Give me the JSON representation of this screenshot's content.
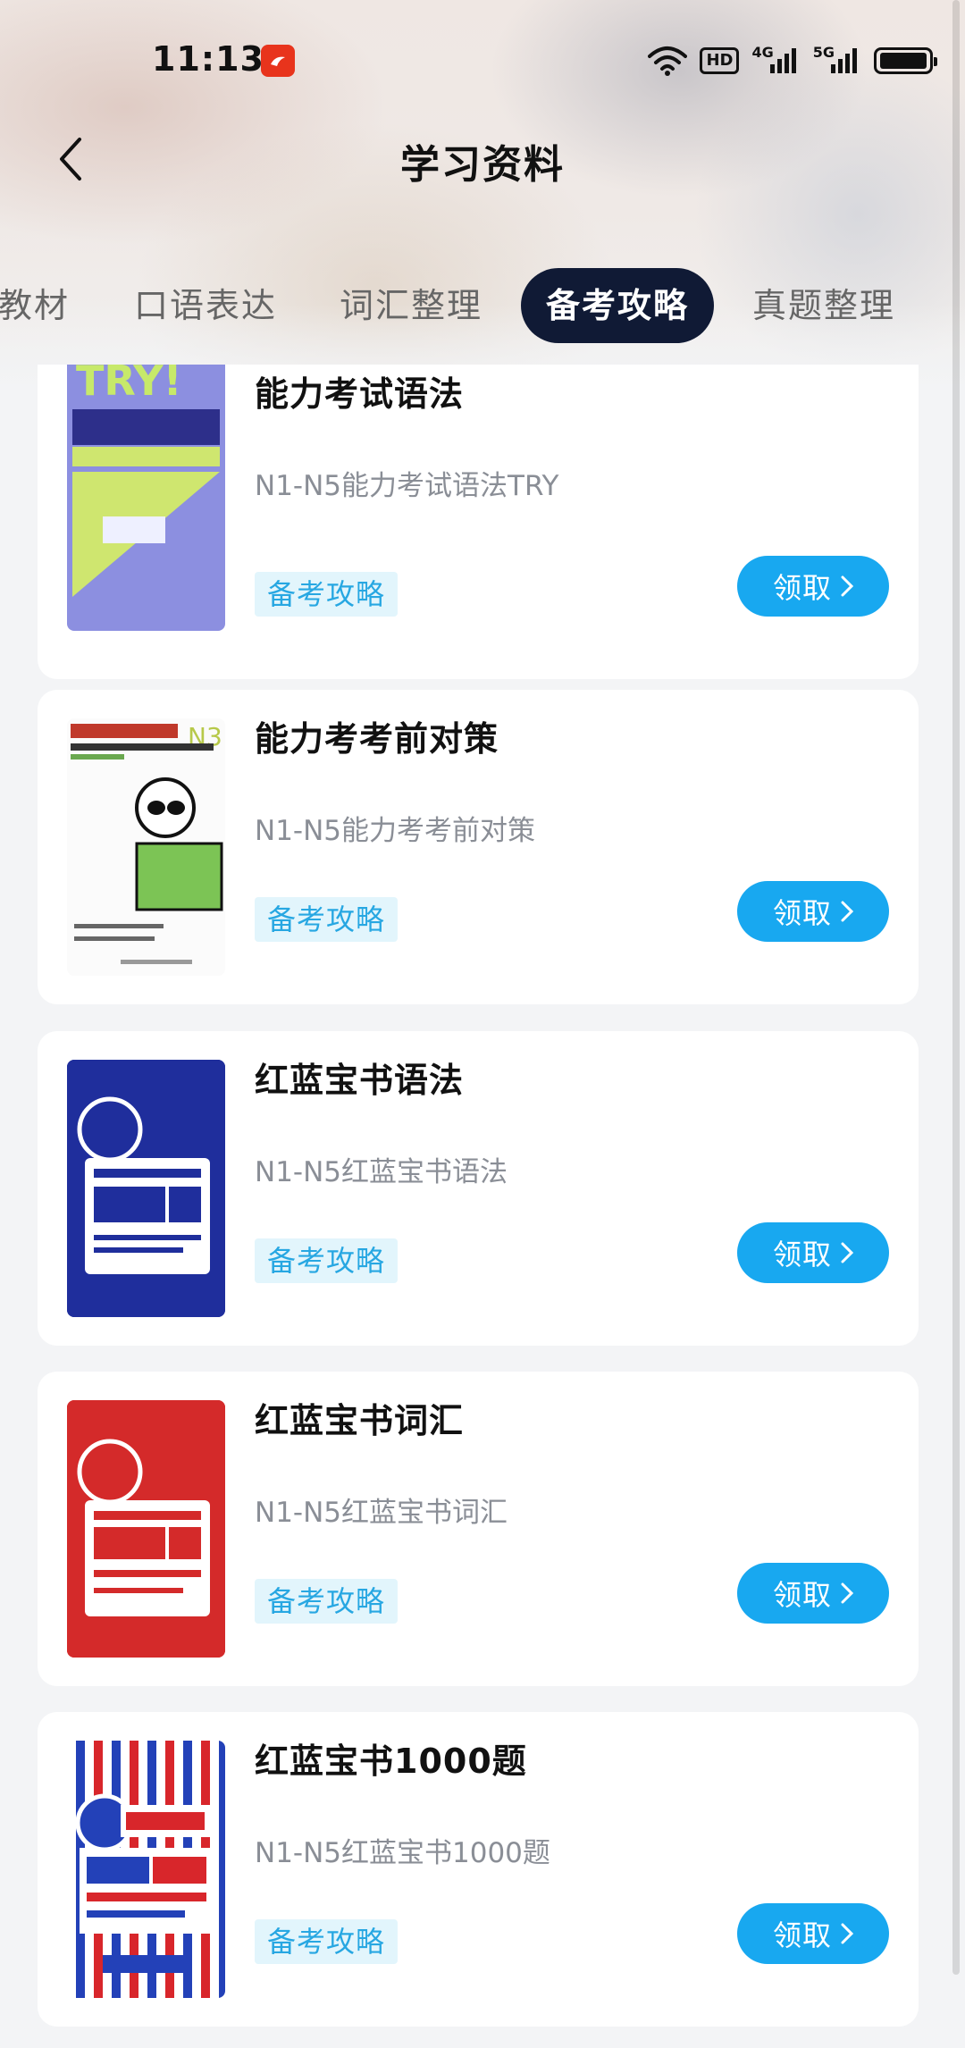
{
  "status_bar": {
    "time": "11:13",
    "hd_label": "HD",
    "net1": "4G",
    "net2": "5G",
    "battery_level": 0.95
  },
  "header": {
    "title": "学习资料"
  },
  "tabs": [
    {
      "label": "教材",
      "active": false
    },
    {
      "label": "口语表达",
      "active": false
    },
    {
      "label": "词汇整理",
      "active": false
    },
    {
      "label": "备考攻略",
      "active": true
    },
    {
      "label": "真题整理",
      "active": false
    }
  ],
  "items": [
    {
      "title": "能力考试语法",
      "desc": "N1-N5能力考试语法TRY",
      "tag": "备考攻略",
      "button": "领取"
    },
    {
      "title": "能力考考前对策",
      "desc": "N1-N5能力考考前对策",
      "tag": "备考攻略",
      "button": "领取"
    },
    {
      "title": "红蓝宝书语法",
      "desc": "N1-N5红蓝宝书语法",
      "tag": "备考攻略",
      "button": "领取"
    },
    {
      "title": "红蓝宝书词汇",
      "desc": "N1-N5红蓝宝书词汇",
      "tag": "备考攻略",
      "button": "领取"
    },
    {
      "title": "红蓝宝书1000题",
      "desc": "N1-N5红蓝宝书1000题",
      "tag": "备考攻略",
      "button": "领取"
    }
  ],
  "colors": {
    "accent": "#18a8f0",
    "tab_active_bg": "#101a35",
    "tag_bg": "#e2f5fc",
    "tag_text": "#27a7e2"
  }
}
